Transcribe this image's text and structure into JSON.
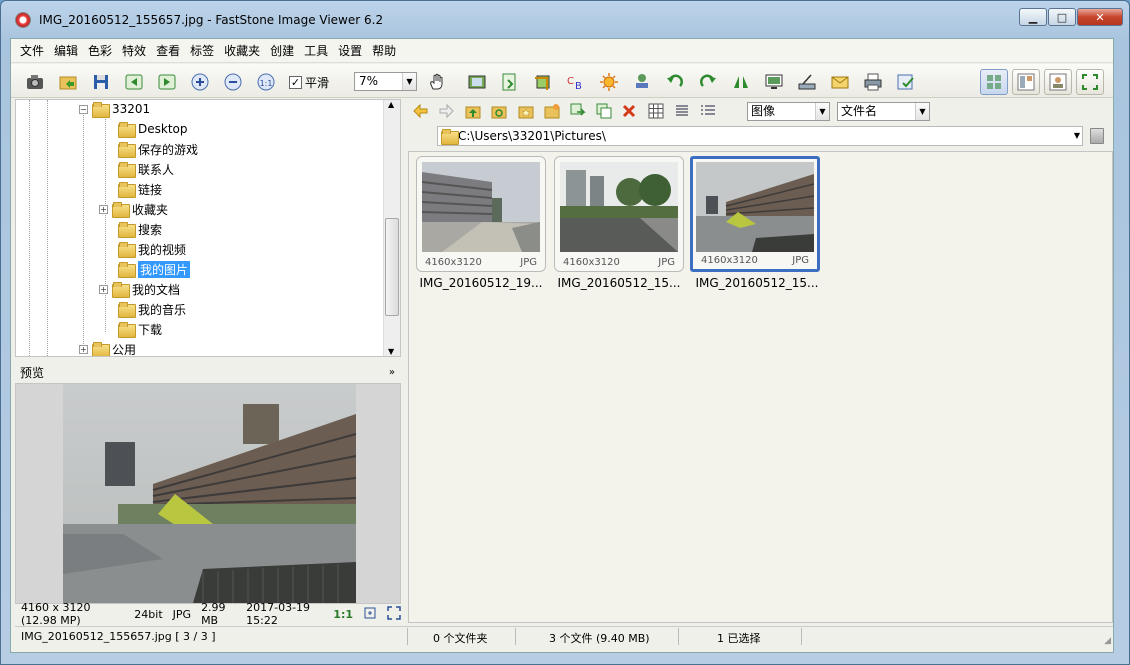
{
  "window": {
    "title": "IMG_20160512_155657.jpg  -  FastStone Image Viewer 6.2",
    "minimize": "▁",
    "maximize": "□",
    "close": "✕"
  },
  "menu": [
    "文件",
    "编辑",
    "色彩",
    "特效",
    "查看",
    "标签",
    "收藏夹",
    "创建",
    "工具",
    "设置",
    "帮助"
  ],
  "toolbar": {
    "smooth_label": "平滑",
    "smooth_checked": true,
    "zoom_value": "7%"
  },
  "tree": {
    "root": "33201",
    "items": [
      "Desktop",
      "保存的游戏",
      "联系人",
      "链接",
      "收藏夹",
      "搜索",
      "我的视频",
      "我的图片",
      "我的文档",
      "我的音乐",
      "下载"
    ],
    "selected": "我的图片",
    "public": "公用"
  },
  "preview": {
    "header": "预览",
    "info": {
      "dimensions": "4160 x 3120 (12.98 MP)",
      "bitdepth": "24bit",
      "format": "JPG",
      "size": "2.99 MB",
      "date": "2017-03-19 15:22",
      "ratio": "1:1"
    }
  },
  "nav": {
    "view_mode": "图像",
    "sort_by": "文件名"
  },
  "path": "C:\\Users\\33201\\Pictures\\",
  "thumbnails": [
    {
      "name": "IMG_20160512_19...",
      "dims": "4160x3120",
      "ext": "JPG",
      "selected": false
    },
    {
      "name": "IMG_20160512_15...",
      "dims": "4160x3120",
      "ext": "JPG",
      "selected": false
    },
    {
      "name": "IMG_20160512_15...",
      "dims": "4160x3120",
      "ext": "JPG",
      "selected": true
    }
  ],
  "status": {
    "file": "IMG_20160512_155657.jpg [ 3 / 3 ]",
    "folders": "0 个文件夹",
    "files": "3 个文件 (9.40 MB)",
    "selected": "1 已选择"
  }
}
